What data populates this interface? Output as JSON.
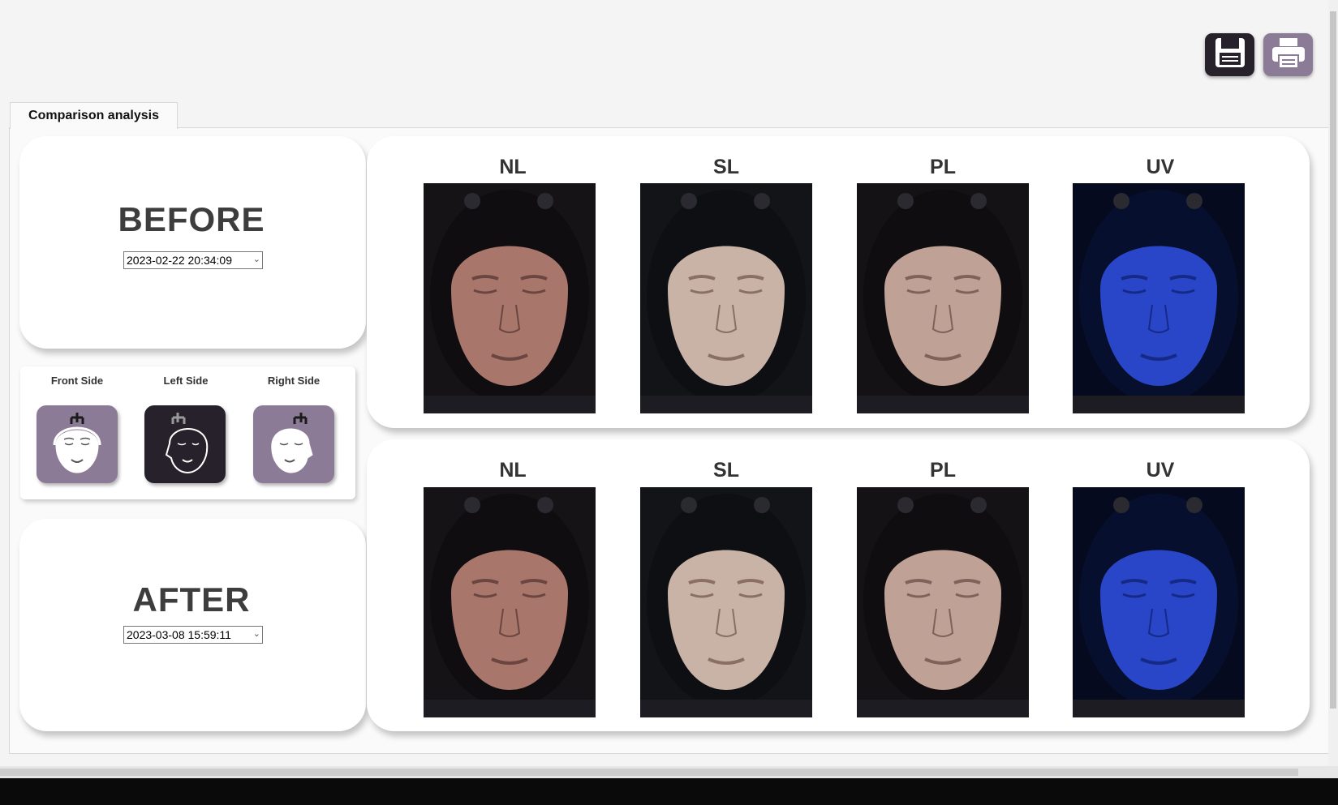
{
  "toolbar": {
    "save_icon": "floppy-disk-icon",
    "print_icon": "printer-icon"
  },
  "tab": {
    "label": "Comparison analysis"
  },
  "before": {
    "title": "BEFORE",
    "date": "2023-02-22 20:34:09",
    "columns": [
      "NL",
      "SL",
      "PL",
      "UV"
    ]
  },
  "after": {
    "title": "AFTER",
    "date": "2023-03-08 15:59:11",
    "columns": [
      "NL",
      "SL",
      "PL",
      "UV"
    ]
  },
  "views": {
    "front_label": "Front Side",
    "left_label": "Left Side",
    "right_label": "Right Side",
    "selected": "Left Side"
  },
  "colors": {
    "accent": "#8c7b97",
    "selected_view": "#26212a",
    "uv_tint": "#1f3fd0"
  }
}
